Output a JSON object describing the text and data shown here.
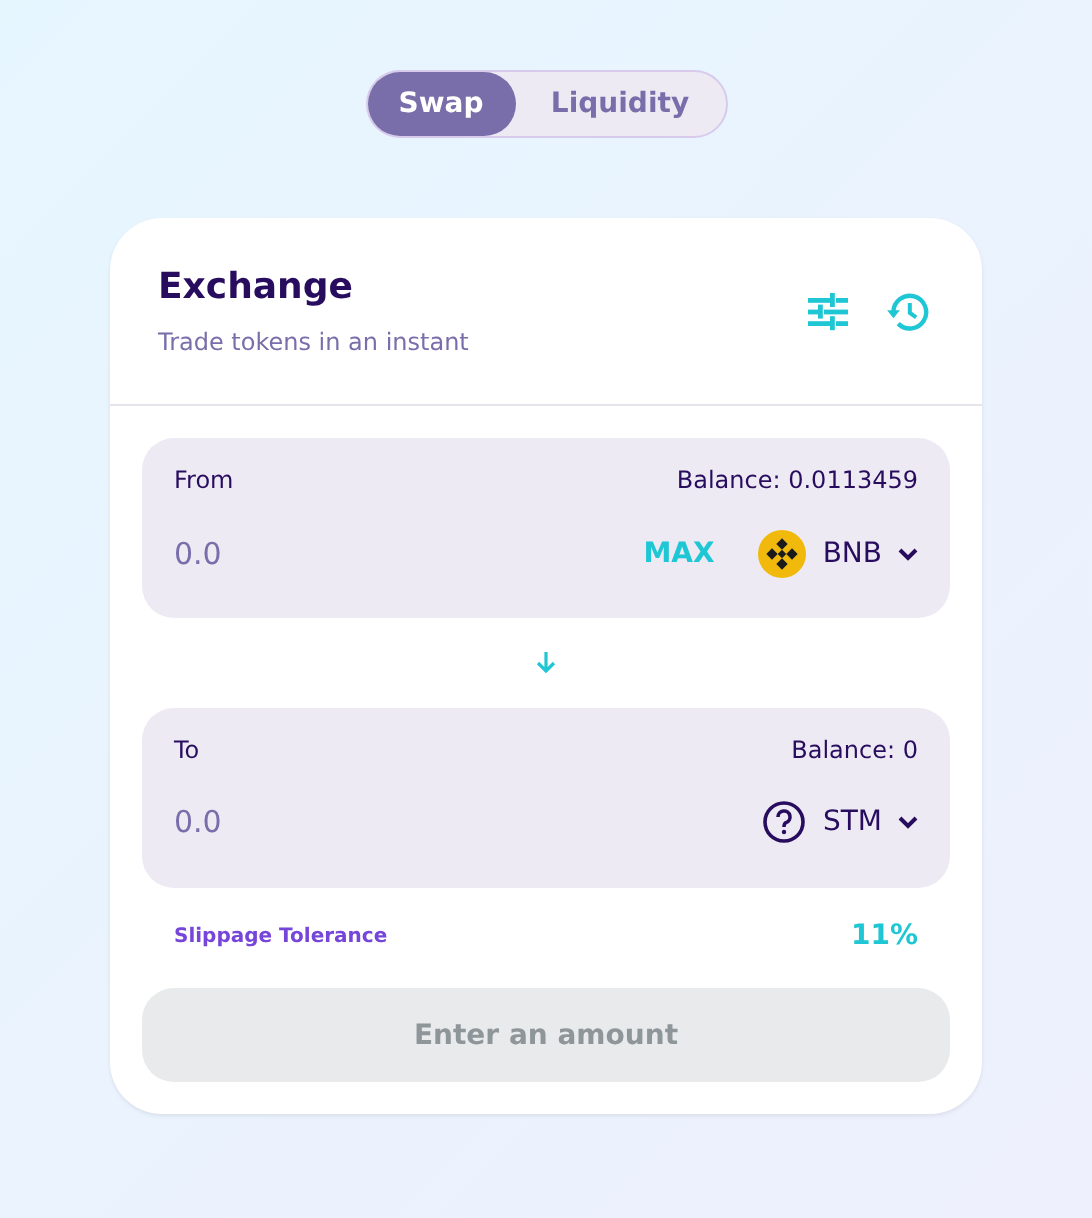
{
  "tabs": [
    {
      "label": "Swap",
      "selected": true
    },
    {
      "label": "Liquidity",
      "selected": false
    }
  ],
  "card": {
    "title": "Exchange",
    "subtitle": "Trade tokens in an instant"
  },
  "inputs": [
    {
      "label": "From",
      "balance": "Balance: 0.0113459",
      "placeholder": "0.0",
      "max": "MAX",
      "token": {
        "symbol": "BNB",
        "kind": "bnb"
      }
    },
    {
      "label": "To",
      "balance": "Balance: 0",
      "placeholder": "0.0",
      "token": {
        "symbol": "STM",
        "kind": "unknown"
      }
    }
  ],
  "slippage": {
    "label": "Slippage Tolerance",
    "value": "11%"
  },
  "submit": {
    "label": "Enter an amount",
    "disabled": true
  }
}
